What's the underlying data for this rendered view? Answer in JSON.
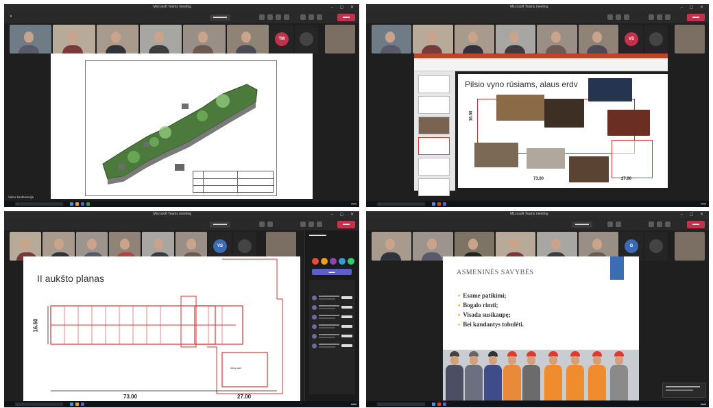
{
  "panels": [
    {
      "window_title": "Microsoft Teams meeting",
      "avatar": {
        "initials": "TM",
        "color": "#c4314b"
      },
      "bottom_label": "Video konferencija"
    },
    {
      "window_title": "Microsoft Teams meeting",
      "avatar": {
        "initials": "VS",
        "color": "#c4314b"
      },
      "slide_title": "Pilsio vyno rūsiams, alaus erdv",
      "dim_vertical": "16.50",
      "dim_bottom_left": "73.00",
      "dim_bottom_right": "27.00"
    },
    {
      "window_title": "Microsoft Teams meeting",
      "avatar": {
        "initials": "VS",
        "color": "#3d6bb3"
      },
      "slide_title": "II aukšto planas",
      "dim_vertical": "16.50",
      "dim_bottom_left": "73.00",
      "dim_bottom_right": "27.00",
      "plan_room_label": "Aktų salė"
    },
    {
      "window_title": "Microsoft Teams meeting",
      "avatar": {
        "initials": "G",
        "color": "#3d6bb3"
      },
      "slide_title": "ASMENINĖS SAVYBĖS",
      "bullets": [
        "Esame patikimi;",
        "Bogalo rimti;",
        "Visada susikaupę;",
        "Bei kandantys tobulėti."
      ]
    }
  ],
  "colors": {
    "teams_dark": "#1f1f1f",
    "accent": "#5b5fc7",
    "leave_red": "#c4314b",
    "plan_red": "#d33333",
    "bullet_orange": "#e8a13a",
    "slide_blue_block": "#3b6db3"
  }
}
